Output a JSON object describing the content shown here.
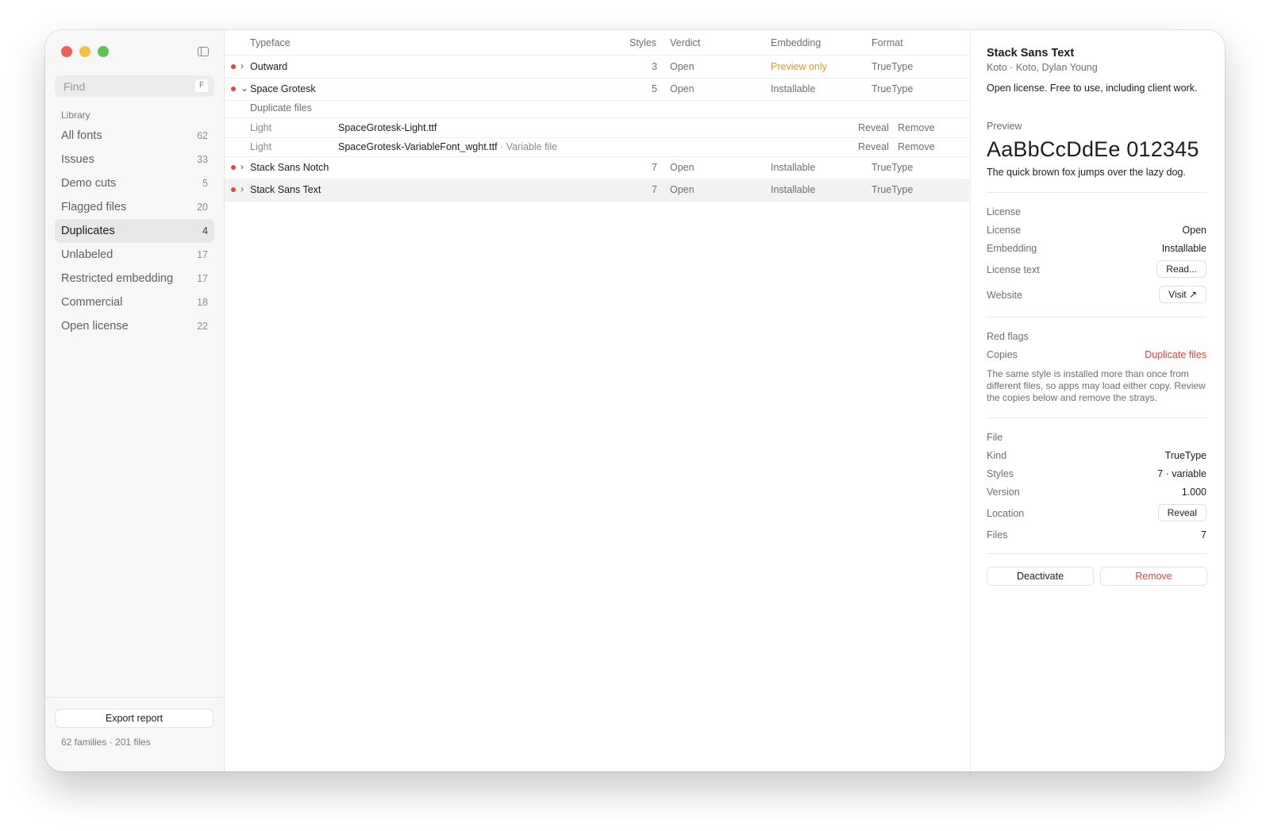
{
  "sidebar": {
    "search_placeholder": "Find",
    "search_shortcut": "F",
    "section_label": "Library",
    "items": [
      {
        "label": "All fonts",
        "count": "62"
      },
      {
        "label": "Issues",
        "count": "33"
      },
      {
        "label": "Demo cuts",
        "count": "5"
      },
      {
        "label": "Flagged files",
        "count": "20"
      },
      {
        "label": "Duplicates",
        "count": "4",
        "active": true
      },
      {
        "label": "Unlabeled",
        "count": "17"
      },
      {
        "label": "Restricted embedding",
        "count": "17"
      },
      {
        "label": "Commercial",
        "count": "18"
      },
      {
        "label": "Open license",
        "count": "22"
      }
    ],
    "export_label": "Export report",
    "status": "62 families · 201 files"
  },
  "table": {
    "headers": {
      "typeface": "Typeface",
      "styles": "Styles",
      "verdict": "Verdict",
      "embedding": "Embedding",
      "format": "Format"
    },
    "rows": [
      {
        "name": "Outward",
        "styles": "3",
        "verdict": "Open",
        "embedding": "Preview only",
        "format": "TrueType",
        "chevron": "›"
      },
      {
        "name": "Space Grotesk",
        "styles": "5",
        "verdict": "Open",
        "embedding": "Installable",
        "format": "TrueType",
        "chevron": "⌄"
      },
      {
        "name": "Stack Sans Notch",
        "styles": "7",
        "verdict": "Open",
        "embedding": "Installable",
        "format": "TrueType",
        "chevron": "›"
      },
      {
        "name": "Stack Sans Text",
        "styles": "7",
        "verdict": "Open",
        "embedding": "Installable",
        "format": "TrueType",
        "chevron": "›"
      }
    ],
    "duplicates": {
      "heading": "Duplicate files",
      "files": [
        {
          "style": "Light",
          "file": "SpaceGrotesk-Light.ttf",
          "extra": "",
          "reveal": "Reveal",
          "remove": "Remove"
        },
        {
          "style": "Light",
          "file": "SpaceGrotesk-VariableFont_wght.ttf",
          "extra": " · Variable file",
          "reveal": "Reveal",
          "remove": "Remove"
        }
      ]
    }
  },
  "inspector": {
    "title": "Stack Sans Text",
    "subtitle": "Koto · Koto, Dylan Young",
    "description": "Open license. Free to use, including client work.",
    "preview_label": "Preview",
    "preview_sample": "AaBbCcDdEe 012345",
    "pangram": "The quick brown fox jumps over the lazy dog.",
    "license_section": "License",
    "license_key": "License",
    "license_value": "Open",
    "embedding_key": "Embedding",
    "embedding_value": "Installable",
    "license_text_key": "License text",
    "license_text_btn": "Read...",
    "website_key": "Website",
    "website_btn": "Visit ↗",
    "red_flags_section": "Red flags",
    "copies_key": "Copies",
    "copies_value": "Duplicate files",
    "red_flags_text": "The same style is installed more than once from different files, so apps may load either copy. Review the copies below and remove the strays.",
    "file_section": "File",
    "kind_key": "Kind",
    "kind_value": "TrueType",
    "styles_key": "Styles",
    "styles_value": "7 · variable",
    "version_key": "Version",
    "version_value": "1.000",
    "location_key": "Location",
    "location_btn": "Reveal",
    "files_key": "Files",
    "files_value": "7",
    "deactivate_label": "Deactivate",
    "remove_label": "Remove"
  },
  "colors": {
    "close": "#ee5f57",
    "minimize": "#f4be3f",
    "zoom": "#5fc454",
    "issue_dot": "#e0463a",
    "warning": "#e39a1f",
    "danger": "#e0463a"
  }
}
